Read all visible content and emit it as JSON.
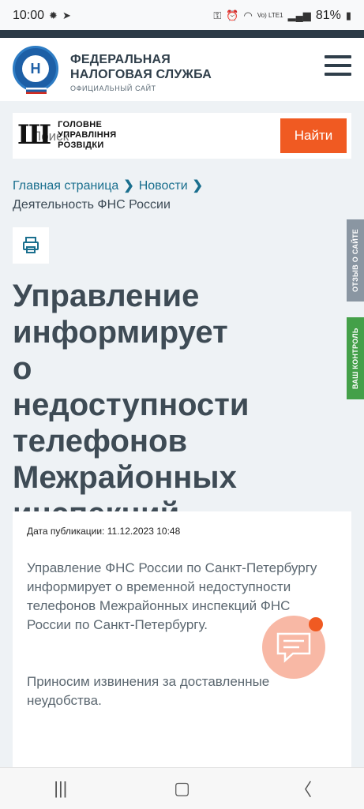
{
  "status_bar": {
    "time": "10:00",
    "network": "Vo) LTE1",
    "battery": "81%"
  },
  "header": {
    "brand_line1": "ФЕДЕРАЛЬНАЯ",
    "brand_line2": "НАЛОГОВАЯ СЛУЖБА",
    "brand_subtitle": "ОФИЦИАЛЬНЫЙ САЙТ",
    "emblem_letter": "Н"
  },
  "watermark": {
    "line1": "ГОЛОВНЕ",
    "line2": "УПРАВЛІННЯ",
    "line3": "РОЗВІДКИ"
  },
  "search": {
    "placeholder": "Поиск",
    "button_label": "Найти"
  },
  "breadcrumb": {
    "items": [
      "Главная страница",
      "Новости"
    ],
    "current": "Деятельность ФНС России"
  },
  "side_tabs": {
    "feedback": "ОТЗЫВ О САЙТЕ",
    "control": "ВАШ КОНТРОЛЬ"
  },
  "article": {
    "title": "Управление информирует о недоступности телефонов Межрайонных инспекций",
    "pub_label": "Дата публикации:",
    "pub_date": "11.12.2023 10:48",
    "paragraph1": "Управление ФНС России по Санкт-Петербургу информирует о временной недоступности телефонов Межрайонных инспекций ФНС России по Санкт-Петербургу.",
    "paragraph2": "Приносим извинения за доставленные неудобства."
  },
  "colors": {
    "accent": "#f05a22",
    "link": "#1a6f8e",
    "header_dark": "#2b3a46",
    "feedback_tab": "#8a96a2",
    "control_tab": "#44a049"
  },
  "icons": {
    "print": "printer-icon",
    "menu": "hamburger-menu-icon",
    "chat": "chat-bubble-icon",
    "nav_recent": "recent-apps-icon",
    "nav_home": "home-icon",
    "nav_back": "back-icon"
  }
}
